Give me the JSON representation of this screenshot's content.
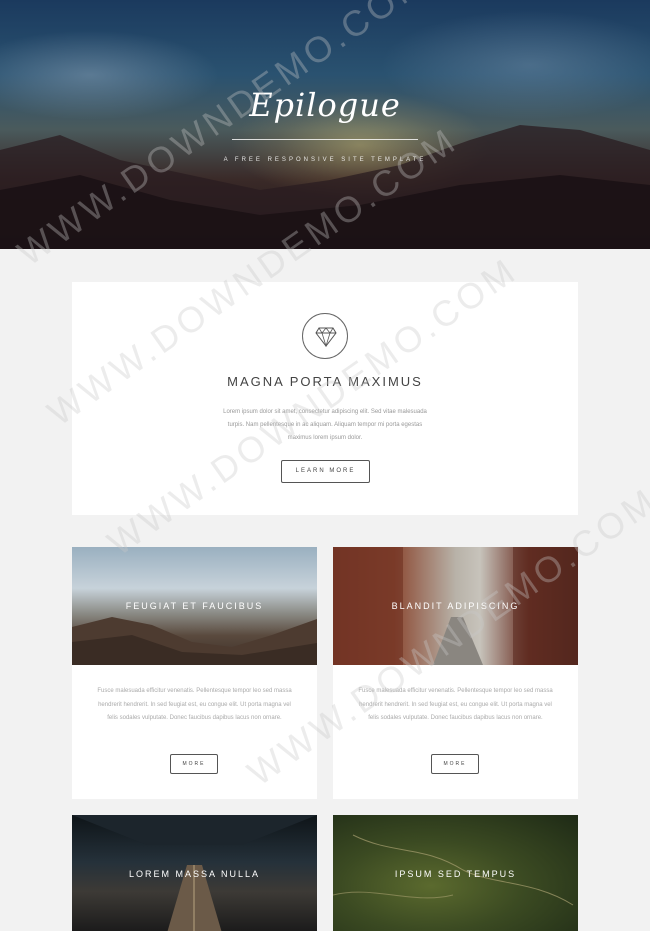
{
  "header": {
    "logo": "Epilogue",
    "tagline": "A FREE RESPONSIVE SITE TEMPLATE"
  },
  "intro": {
    "icon": "diamond-icon",
    "title": "MAGNA PORTA MAXIMUS",
    "text": "Lorem ipsum dolor sit amet, consectetur adipiscing elit. Sed vitae malesuada turpis. Nam pellentesque in ac aliquam. Aliquam tempor mi porta egestas maximus lorem ipsum dolor.",
    "button": "LEARN MORE"
  },
  "cards": [
    {
      "title": "FEUGIAT ET FAUCIBUS",
      "text": "Fusce malesuada efficitur venenatis. Pellentesque tempor leo sed massa hendrerit hendrerit. In sed feugiat est, eu congue elit. Ut porta magna vel felis sodales vulputate. Donec faucibus dapibus lacus non ornare.",
      "button": "MORE"
    },
    {
      "title": "BLANDIT ADIPISCING",
      "text": "Fusce malesuada efficitur venenatis. Pellentesque tempor leo sed massa hendrerit hendrerit. In sed feugiat est, eu congue elit. Ut porta magna vel felis sodales vulputate. Donec faucibus dapibus lacus non ornare.",
      "button": "MORE"
    },
    {
      "title": "LOREM MASSA NULLA"
    },
    {
      "title": "IPSUM SED TEMPUS"
    }
  ],
  "watermark": "WWW.DOWNDEMO.COM",
  "colors": {
    "page_bg": "#f2f2f2",
    "card_bg": "#ffffff",
    "text": "#444444",
    "muted": "#aaaaaa"
  }
}
